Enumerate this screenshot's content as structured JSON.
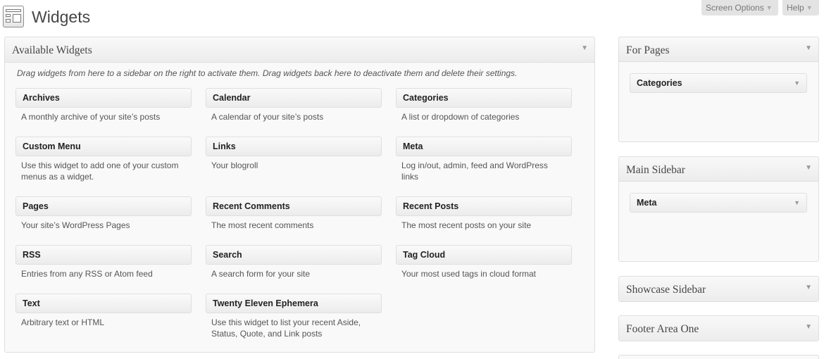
{
  "header": {
    "title": "Widgets",
    "screen_options": "Screen Options",
    "help": "Help",
    "arrow_glyph": "▼"
  },
  "available": {
    "title": "Available Widgets",
    "description": "Drag widgets from here to a sidebar on the right to activate them. Drag widgets back here to deactivate them and delete their settings.",
    "widgets": [
      {
        "title": "Archives",
        "desc": "A monthly archive of your site’s posts"
      },
      {
        "title": "Calendar",
        "desc": "A calendar of your site’s posts"
      },
      {
        "title": "Categories",
        "desc": "A list or dropdown of categories"
      },
      {
        "title": "Custom Menu",
        "desc": "Use this widget to add one of your custom menus as a widget."
      },
      {
        "title": "Links",
        "desc": "Your blogroll"
      },
      {
        "title": "Meta",
        "desc": "Log in/out, admin, feed and WordPress links"
      },
      {
        "title": "Pages",
        "desc": "Your site’s WordPress Pages"
      },
      {
        "title": "Recent Comments",
        "desc": "The most recent comments"
      },
      {
        "title": "Recent Posts",
        "desc": "The most recent posts on your site"
      },
      {
        "title": "RSS",
        "desc": "Entries from any RSS or Atom feed"
      },
      {
        "title": "Search",
        "desc": "A search form for your site"
      },
      {
        "title": "Tag Cloud",
        "desc": "Your most used tags in cloud format"
      },
      {
        "title": "Text",
        "desc": "Arbitrary text or HTML"
      },
      {
        "title": "Twenty Eleven Ephemera",
        "desc": "Use this widget to list your recent Aside, Status, Quote, and Link posts"
      }
    ]
  },
  "sidebars": [
    {
      "title": "For Pages",
      "widget": "Categories"
    },
    {
      "title": "Main Sidebar",
      "widget": "Meta"
    },
    {
      "title": "Showcase Sidebar"
    },
    {
      "title": "Footer Area One"
    }
  ]
}
